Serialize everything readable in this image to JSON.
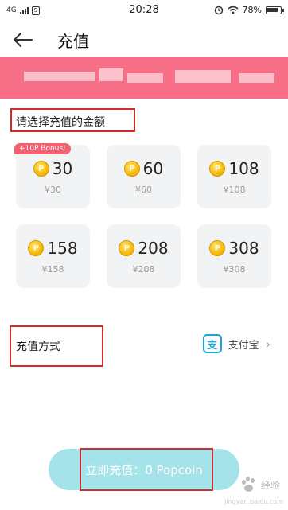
{
  "status_bar": {
    "network": "4G",
    "sim_label": "S",
    "time": "20:28",
    "battery_text": "78%"
  },
  "header": {
    "title": "充值"
  },
  "amount_section": {
    "title": "请选择充值的金额",
    "options": [
      {
        "amount": "30",
        "price": "¥30",
        "badge": "+10P Bonus!"
      },
      {
        "amount": "60",
        "price": "¥60"
      },
      {
        "amount": "108",
        "price": "¥108"
      },
      {
        "amount": "158",
        "price": "¥158"
      },
      {
        "amount": "208",
        "price": "¥208"
      },
      {
        "amount": "308",
        "price": "¥308"
      }
    ],
    "coin_letter": "P"
  },
  "payment_method": {
    "label": "充值方式",
    "alipay_icon_letter": "支",
    "alipay_label": "支付宝"
  },
  "pay_button": {
    "label": "立即充值：0 Popcoin"
  },
  "watermark": {
    "text": "经验",
    "sub": "jingyan.baidu.com"
  },
  "colors": {
    "banner": "#f76f86",
    "highlight_box": "#d42b2b",
    "option_bg": "#f2f3f5",
    "bonus_badge": "#f2616f",
    "pay_button": "#a4e3ea",
    "alipay_blue": "#1fa2d6"
  }
}
